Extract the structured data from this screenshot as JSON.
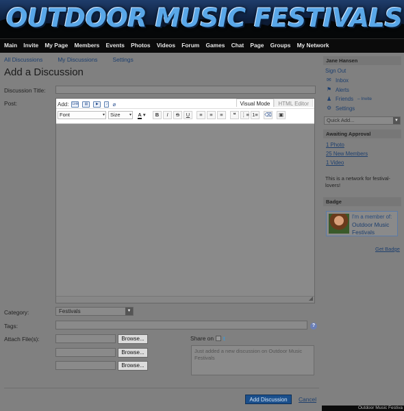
{
  "header": {
    "site_title": "OUTDOOR MUSIC FESTIVALS"
  },
  "nav": [
    "Main",
    "Invite",
    "My Page",
    "Members",
    "Events",
    "Photos",
    "Videos",
    "Forum",
    "Games",
    "Chat",
    "Page",
    "Groups",
    "My Network"
  ],
  "subnav": [
    "All Discussions",
    "My Discussions",
    "Settings"
  ],
  "page_title": "Add a Discussion",
  "form": {
    "title_label": "Discussion Title:",
    "post_label": "Post:",
    "editor": {
      "add_label": "Add:",
      "add_icons": [
        "link-icon",
        "image-icon",
        "video-icon",
        "music-icon",
        "attachment-icon"
      ],
      "mode_visual": "Visual Mode",
      "mode_html": "HTML Editor",
      "font_select": "Font",
      "size_select": "Size",
      "format_buttons": [
        "A",
        "B",
        "I",
        "S",
        "U",
        "≡",
        "≡",
        "≡",
        "❝",
        "⋮≡",
        "1≡",
        "⌫",
        "▣"
      ]
    },
    "category_label": "Category:",
    "category_value": "Festivals",
    "tags_label": "Tags:",
    "attach_label": "Attach File(s):",
    "browse_label": "Browse...",
    "share_label": "Share on",
    "share_text": "Just added a new discussion on Outdoor Music Festivals",
    "submit_label": "Add Discussion",
    "cancel_label": "Cancel"
  },
  "sidebar": {
    "user_name": "Jane Hansen",
    "sign_out": "Sign Out",
    "links": [
      "Inbox",
      "Alerts",
      "Friends",
      "Settings"
    ],
    "invite_label": "– Invite",
    "quick_add": "Quick Add...",
    "awaiting_title": "Awaiting Approval",
    "awaiting_items": [
      "1 Photo",
      "25 New Members",
      "1 Video"
    ],
    "note": "This is a network for festival-lovers!",
    "badge_title": "Badge",
    "badge_line1": "I'm a member of:",
    "badge_line2": "Outdoor Music Festivals",
    "get_badge": "Get Badge",
    "footer": "Outdoor Music Festiva"
  }
}
